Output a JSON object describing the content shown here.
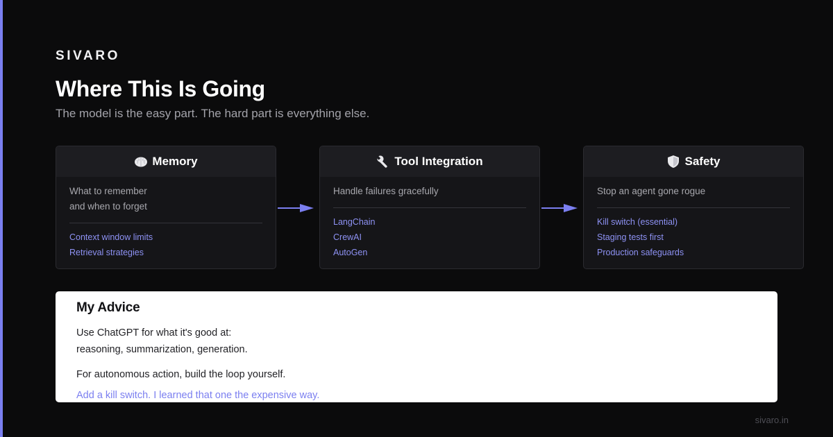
{
  "brand": "SIVARO",
  "title": "Where This Is Going",
  "subtitle": "The model is the easy part. The hard part is everything else.",
  "cards": [
    {
      "icon": "brain-icon",
      "title": "Memory",
      "desc": [
        "What to remember",
        "and when to forget"
      ],
      "links": [
        "Context window limits",
        "Retrieval strategies"
      ]
    },
    {
      "icon": "wrench-icon",
      "title": "Tool Integration",
      "desc": [
        "Handle failures gracefully"
      ],
      "links": [
        "LangChain",
        "CrewAI",
        "AutoGen"
      ]
    },
    {
      "icon": "shield-icon",
      "title": "Safety",
      "desc": [
        "Stop an agent gone rogue"
      ],
      "links": [
        "Kill switch (essential)",
        "Staging tests first",
        "Production safeguards"
      ]
    }
  ],
  "advice": {
    "title": "My Advice",
    "line1": "Use ChatGPT for what it's good at:",
    "line2": "reasoning, summarization, generation.",
    "line3": "For autonomous action, build the loop yourself.",
    "highlight": "Add a kill switch. I learned that one the expensive way."
  },
  "footer": "sivaro.in",
  "colors": {
    "background": "#0b0b0c",
    "accent": "#7b7ff0",
    "card_bg": "#151518",
    "card_header_bg": "#1d1d21",
    "link": "#8e92f4"
  }
}
